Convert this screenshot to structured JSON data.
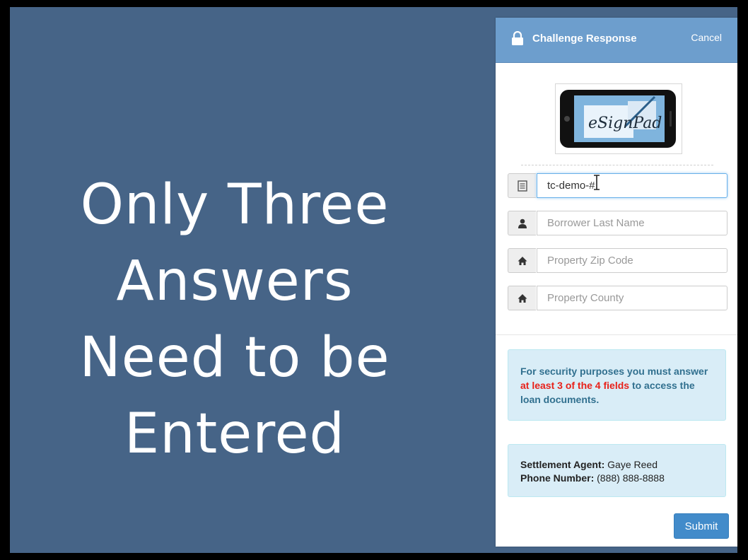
{
  "slide": {
    "lines": [
      "Only Three",
      "Answers",
      "Need to be",
      "Entered"
    ]
  },
  "dialog": {
    "title": "Challenge Response",
    "cancel_label": "Cancel",
    "logo_icon": "esignpad-logo",
    "logo_text": "eSignPad",
    "fields": [
      {
        "icon": "document-icon",
        "value": "tc-demo-#",
        "placeholder": ""
      },
      {
        "icon": "user-icon",
        "value": "",
        "placeholder": "Borrower Last Name"
      },
      {
        "icon": "home-icon",
        "value": "",
        "placeholder": "Property Zip Code"
      },
      {
        "icon": "home-icon",
        "value": "",
        "placeholder": "Property County"
      }
    ],
    "security": {
      "part1": "For security purposes you must answer ",
      "highlight": "at least 3 of the 4 fields",
      "part2": " to access the loan documents."
    },
    "agent": {
      "agent_label": "Settlement Agent:",
      "agent_name": "Gaye Reed",
      "phone_label": "Phone Number:",
      "phone": "(888) 888-8888"
    },
    "submit_label": "Submit"
  },
  "colors": {
    "background": "#466487",
    "header": "#6d9ecd",
    "info_box": "#d9edf7",
    "highlight": "#e8211a",
    "submit": "#428bca"
  }
}
